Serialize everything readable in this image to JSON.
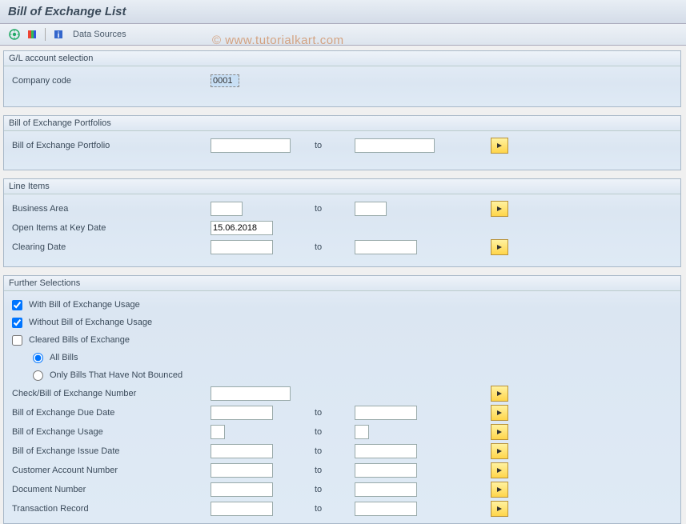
{
  "title": "Bill of Exchange List",
  "toolbar": {
    "data_sources": "Data Sources"
  },
  "watermark": "© www.tutorialkart.com",
  "groups": {
    "gl": {
      "header": "G/L account selection",
      "company_code_label": "Company code",
      "company_code_value": "0001"
    },
    "portfolios": {
      "header": "Bill of Exchange Portfolios",
      "portfolio_label": "Bill of Exchange Portfolio",
      "to": "to",
      "from_val": "",
      "to_val": ""
    },
    "line_items": {
      "header": "Line Items",
      "business_area_label": "Business Area",
      "open_items_label": "Open Items at Key Date",
      "open_items_value": "15.06.2018",
      "clearing_date_label": "Clearing Date",
      "to": "to",
      "ba_from": "",
      "ba_to": "",
      "cd_from": "",
      "cd_to": ""
    },
    "further": {
      "header": "Further Selections",
      "with_usage_label": "With Bill of Exchange Usage",
      "without_usage_label": "Without Bill of Exchange Usage",
      "cleared_label": "Cleared Bills of Exchange",
      "all_bills_label": "All Bills",
      "not_bounced_label": "Only Bills That Have Not Bounced",
      "check_number_label": "Check/Bill of Exchange Number",
      "due_date_label": "Bill of Exchange Due Date",
      "usage_label": "Bill of Exchange Usage",
      "issue_date_label": "Bill of Exchange Issue Date",
      "cust_acct_label": "Customer Account Number",
      "doc_number_label": "Document Number",
      "trans_record_label": "Transaction Record",
      "to": "to",
      "with_usage_checked": true,
      "without_usage_checked": true,
      "cleared_checked": false,
      "all_bills_selected": true,
      "not_bounced_selected": false,
      "check_from": "",
      "due_from": "",
      "due_to": "",
      "usage_from": "",
      "usage_to": "",
      "issue_from": "",
      "issue_to": "",
      "cust_from": "",
      "cust_to": "",
      "doc_from": "",
      "doc_to": "",
      "trans_from": "",
      "trans_to": ""
    }
  }
}
